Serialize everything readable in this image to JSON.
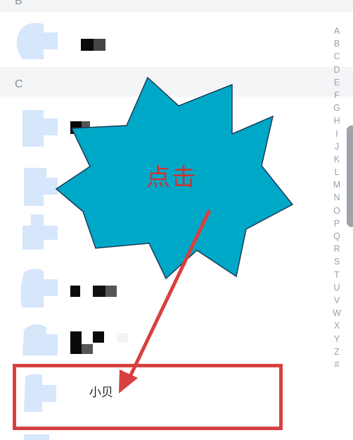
{
  "sections": {
    "b": {
      "letter": "B"
    },
    "c": {
      "letter": "C"
    }
  },
  "contacts": {
    "target_name": "小贝"
  },
  "alphabet_index": [
    "A",
    "B",
    "C",
    "D",
    "E",
    "F",
    "G",
    "H",
    "I",
    "J",
    "K",
    "L",
    "M",
    "N",
    "O",
    "P",
    "Q",
    "R",
    "S",
    "T",
    "U",
    "V",
    "W",
    "X",
    "Y",
    "Z",
    "#"
  ],
  "annotation": {
    "callout_text": "点击",
    "callout_color": "#00a8c8",
    "text_color": "#d0332f",
    "arrow_color": "#d8403f"
  },
  "colors": {
    "avatar_fill": "#d6e6fb",
    "section_bg": "#f4f5f7"
  }
}
